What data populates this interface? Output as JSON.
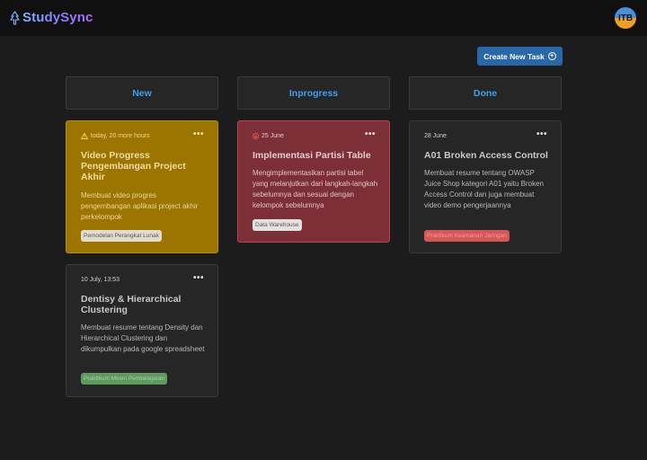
{
  "app": {
    "brand": "StudySync",
    "avatar_text": "ITB"
  },
  "toolbar": {
    "create_label": "Create New Task"
  },
  "columns": [
    {
      "label": "New"
    },
    {
      "label": "Inprogress"
    },
    {
      "label": "Done"
    }
  ],
  "cards": [
    {
      "date": "today, 20 more hours",
      "title": "Video Progress Pengembangan Project Akhir",
      "description": "Membuat video progres pengembangan aplikasi project akhir perkelompok",
      "tag": "Pemodelan Perangkat Lunak"
    },
    {
      "date": "10 July, 13:53",
      "title": "Dentisy & Hierarchical Clustering",
      "description": "Membuat resume tentang Density dan Hierarchical Clustering dan dikumpulkan pada google spreadsheet",
      "tag": "Praktikum Mesin Pembelajaran"
    },
    {
      "date": "25 June",
      "title": "Implementasi Partisi Table",
      "description": "Mengimplementasikan partisi tabel yang melanjutkan dari langkah-langkah sebelumnya dan sesuai dengan kelompok sebelumnya",
      "tag": "Data Warehouse"
    },
    {
      "date": "28 June",
      "title": "A01 Broken Access Control",
      "description": "Membuat resume tentang OWASP Juice Shop kategori A01 yaitu Broken Access Control dan juga membuat video demo pengerjaannya",
      "tag": "Praktikum Keamanan Jaringan"
    }
  ],
  "menu_glyph": "•••",
  "colors": {
    "header_text": "#3ba0f0",
    "warning_card": "#9c7400",
    "overdue_card": "#7c2f36",
    "button": "#2a67a8"
  }
}
